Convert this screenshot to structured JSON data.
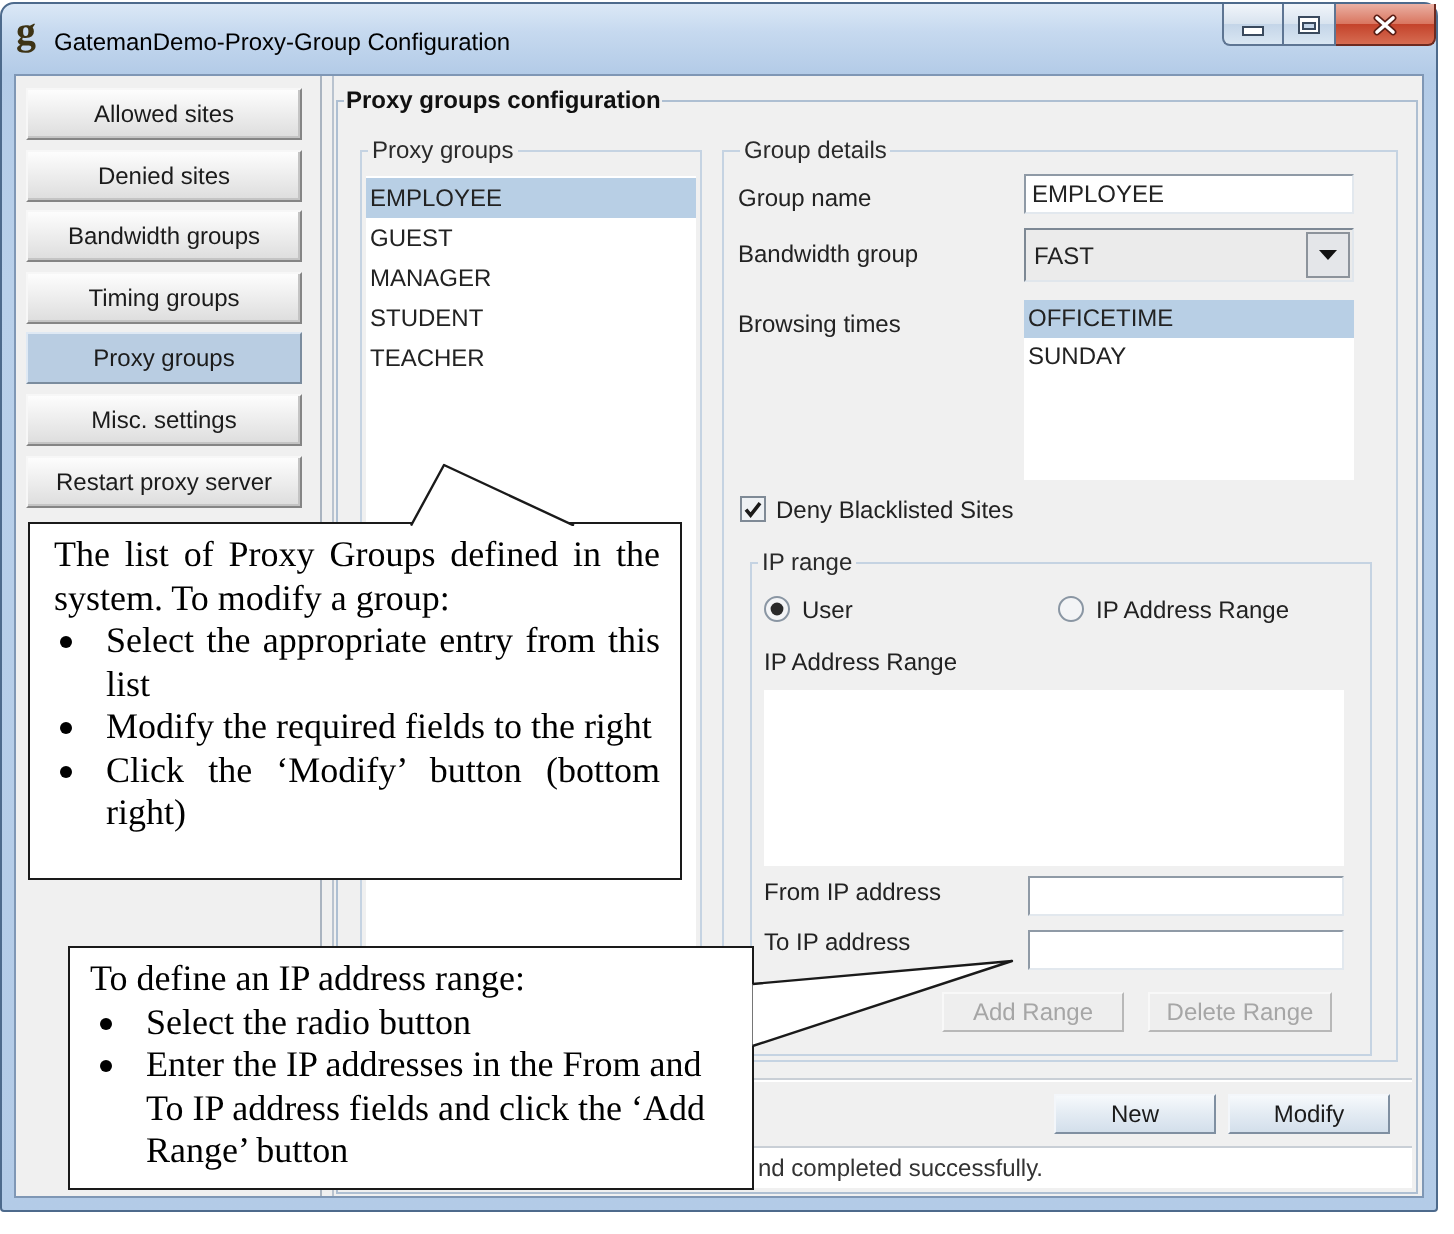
{
  "window": {
    "logo": "g",
    "title": "GatemanDemo-Proxy-Group Configuration"
  },
  "sidebar": {
    "items": [
      {
        "label": "Allowed sites",
        "selected": false
      },
      {
        "label": "Denied sites",
        "selected": false
      },
      {
        "label": "Bandwidth groups",
        "selected": false
      },
      {
        "label": "Timing groups",
        "selected": false
      },
      {
        "label": "Proxy groups",
        "selected": true
      },
      {
        "label": "Misc. settings",
        "selected": false
      },
      {
        "label": "Restart proxy server",
        "selected": false
      }
    ]
  },
  "panel": {
    "title": "Proxy groups configuration"
  },
  "proxy_groups": {
    "title": "Proxy groups",
    "items": [
      {
        "label": "EMPLOYEE",
        "selected": true
      },
      {
        "label": "GUEST",
        "selected": false
      },
      {
        "label": "MANAGER",
        "selected": false
      },
      {
        "label": "STUDENT",
        "selected": false
      },
      {
        "label": "TEACHER",
        "selected": false
      }
    ]
  },
  "group_details": {
    "title": "Group details",
    "group_name": {
      "label": "Group name",
      "value": "EMPLOYEE"
    },
    "bandwidth_group": {
      "label": "Bandwidth group",
      "value": "FAST"
    },
    "browsing_times": {
      "label": "Browsing times",
      "items": [
        {
          "label": "OFFICETIME",
          "selected": true
        },
        {
          "label": "SUNDAY",
          "selected": false
        }
      ]
    },
    "deny_blacklisted": {
      "label": "Deny Blacklisted Sites",
      "checked": true
    }
  },
  "ip_range": {
    "title": "IP range",
    "options": [
      {
        "label": "User",
        "selected": true
      },
      {
        "label": "IP Address Range",
        "selected": false
      }
    ],
    "list_label": "IP Address Range",
    "from_ip": {
      "label": "From IP address"
    },
    "to_ip": {
      "label": "To IP address"
    },
    "buttons": [
      {
        "label": "Add Range",
        "disabled": true
      },
      {
        "label": "Delete Range",
        "disabled": true
      }
    ]
  },
  "actions": [
    {
      "label": "New"
    },
    {
      "label": "Modify"
    }
  ],
  "status_bar": {
    "text": "nd completed successfully."
  },
  "callouts": [
    {
      "text": "The list of Proxy Groups defined in the system. To modify a group:",
      "bullets": [
        "Select the appropriate entry from this list",
        "Modify the required fields to the right",
        "Click the ‘Modify’ button (bottom right)"
      ]
    },
    {
      "text": "To define an IP address range:",
      "bullets": [
        "Select the radio button",
        "Enter the IP addresses in the From and To IP address fields and click the ‘Add Range’ button"
      ]
    }
  ]
}
